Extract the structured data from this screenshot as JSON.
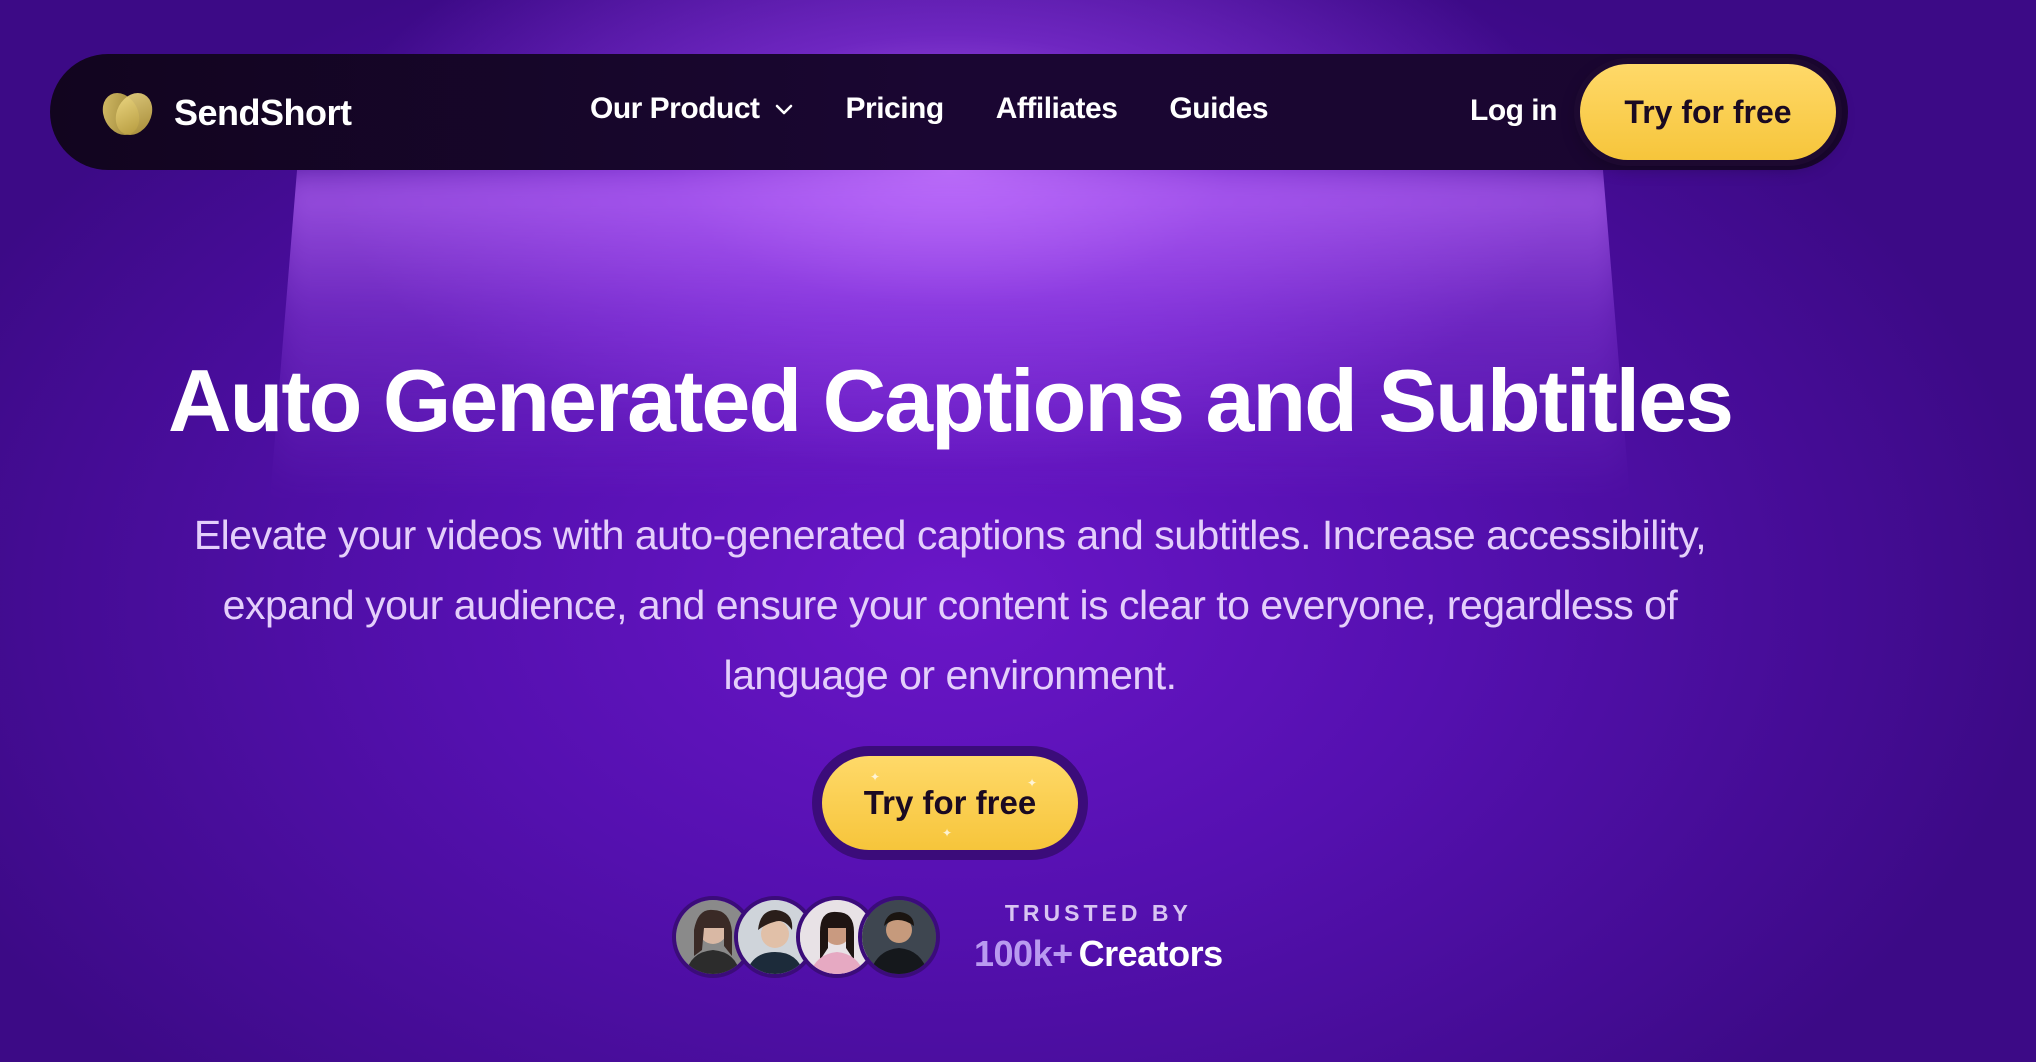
{
  "brand": {
    "name": "SendShort",
    "logo_icon": "brand-logo-icon",
    "accent": "#f6c53b"
  },
  "nav": {
    "items": [
      {
        "label": "Our Product",
        "icon": "chevron-down-icon"
      },
      {
        "label": "Pricing"
      },
      {
        "label": "Affiliates"
      },
      {
        "label": "Guides"
      }
    ],
    "login_label": "Log in",
    "cta_label": "Try for free"
  },
  "hero": {
    "title": "Auto Generated Captions and Subtitles",
    "subtitle": "Elevate your videos with auto-generated captions and subtitles. Increase accessibility, expand your audience, and ensure your content is clear to everyone, regardless of language or environment.",
    "cta_label": "Try for free"
  },
  "trust": {
    "label": "TRUSTED BY",
    "count": "100k+",
    "creators_label": "Creators",
    "avatars": [
      "avatar-1",
      "avatar-2",
      "avatar-3",
      "avatar-4"
    ]
  },
  "colors": {
    "background": "#5511b2",
    "navbar": "#16052a",
    "button": "#f6c53b",
    "button_text": "#1a0a22"
  }
}
